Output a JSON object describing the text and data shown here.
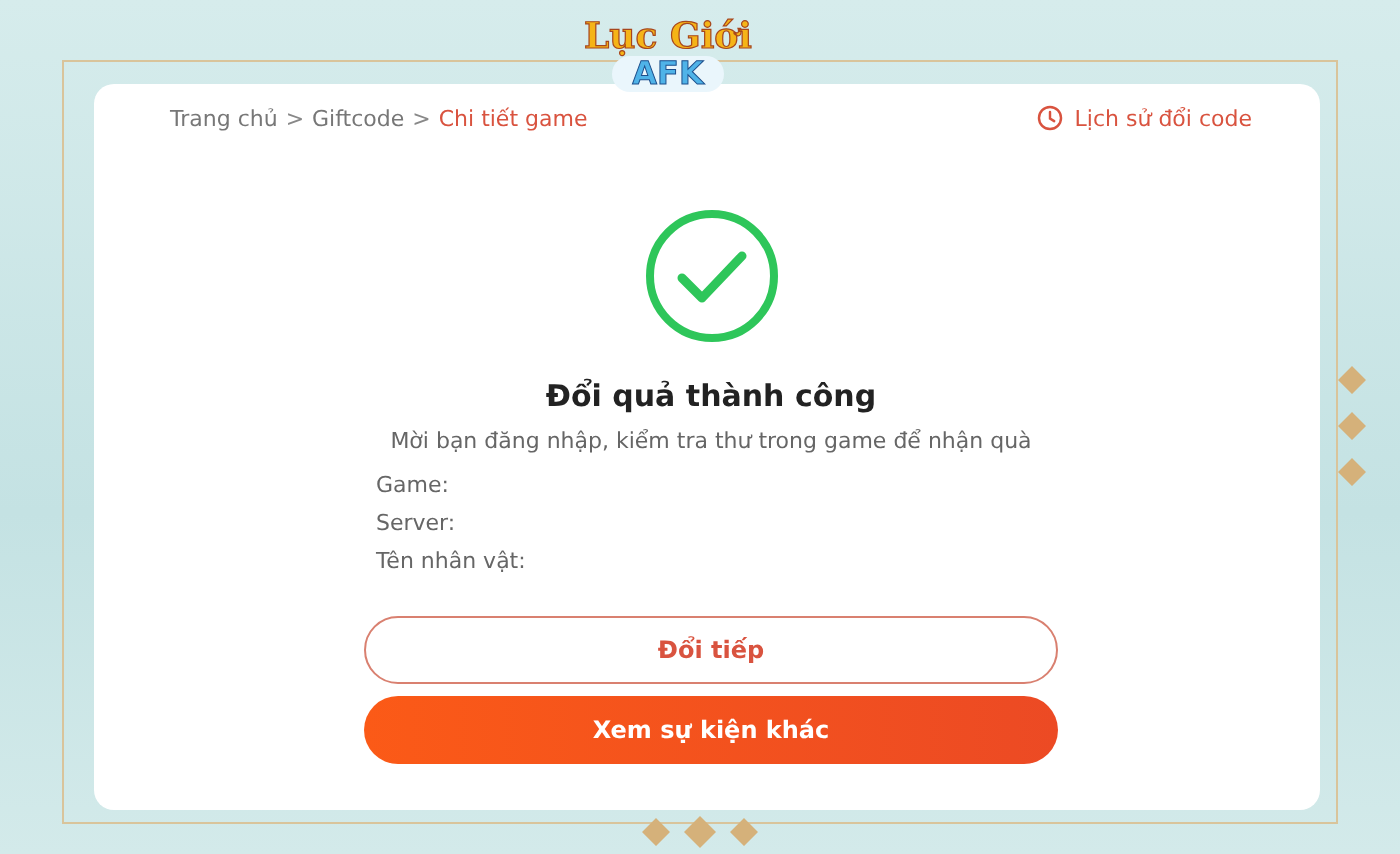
{
  "logo": {
    "line_1": "Lục Giới",
    "line_2": "AFK"
  },
  "breadcrumb": [
    {
      "label": "Trang chủ",
      "selected": false
    },
    {
      "label": "Giftcode",
      "selected": false
    },
    {
      "label": "Chi tiết game",
      "selected": true
    }
  ],
  "breadcrumb_separator": ">",
  "history_link": {
    "label": "Lịch sử đổi code"
  },
  "result": {
    "title": "Đổi quả thành công",
    "message": "Mời bạn đăng nhập, kiểm tra thư trong game để nhận quà"
  },
  "fields": [
    {
      "label": "Game:"
    },
    {
      "label": "Server:"
    },
    {
      "label": "Tên nhân vật:"
    }
  ],
  "buttons": [
    {
      "label": "Đổi tiếp",
      "kind": "outline"
    },
    {
      "label": "Xem sự kiện khác",
      "kind": "filled"
    }
  ]
}
